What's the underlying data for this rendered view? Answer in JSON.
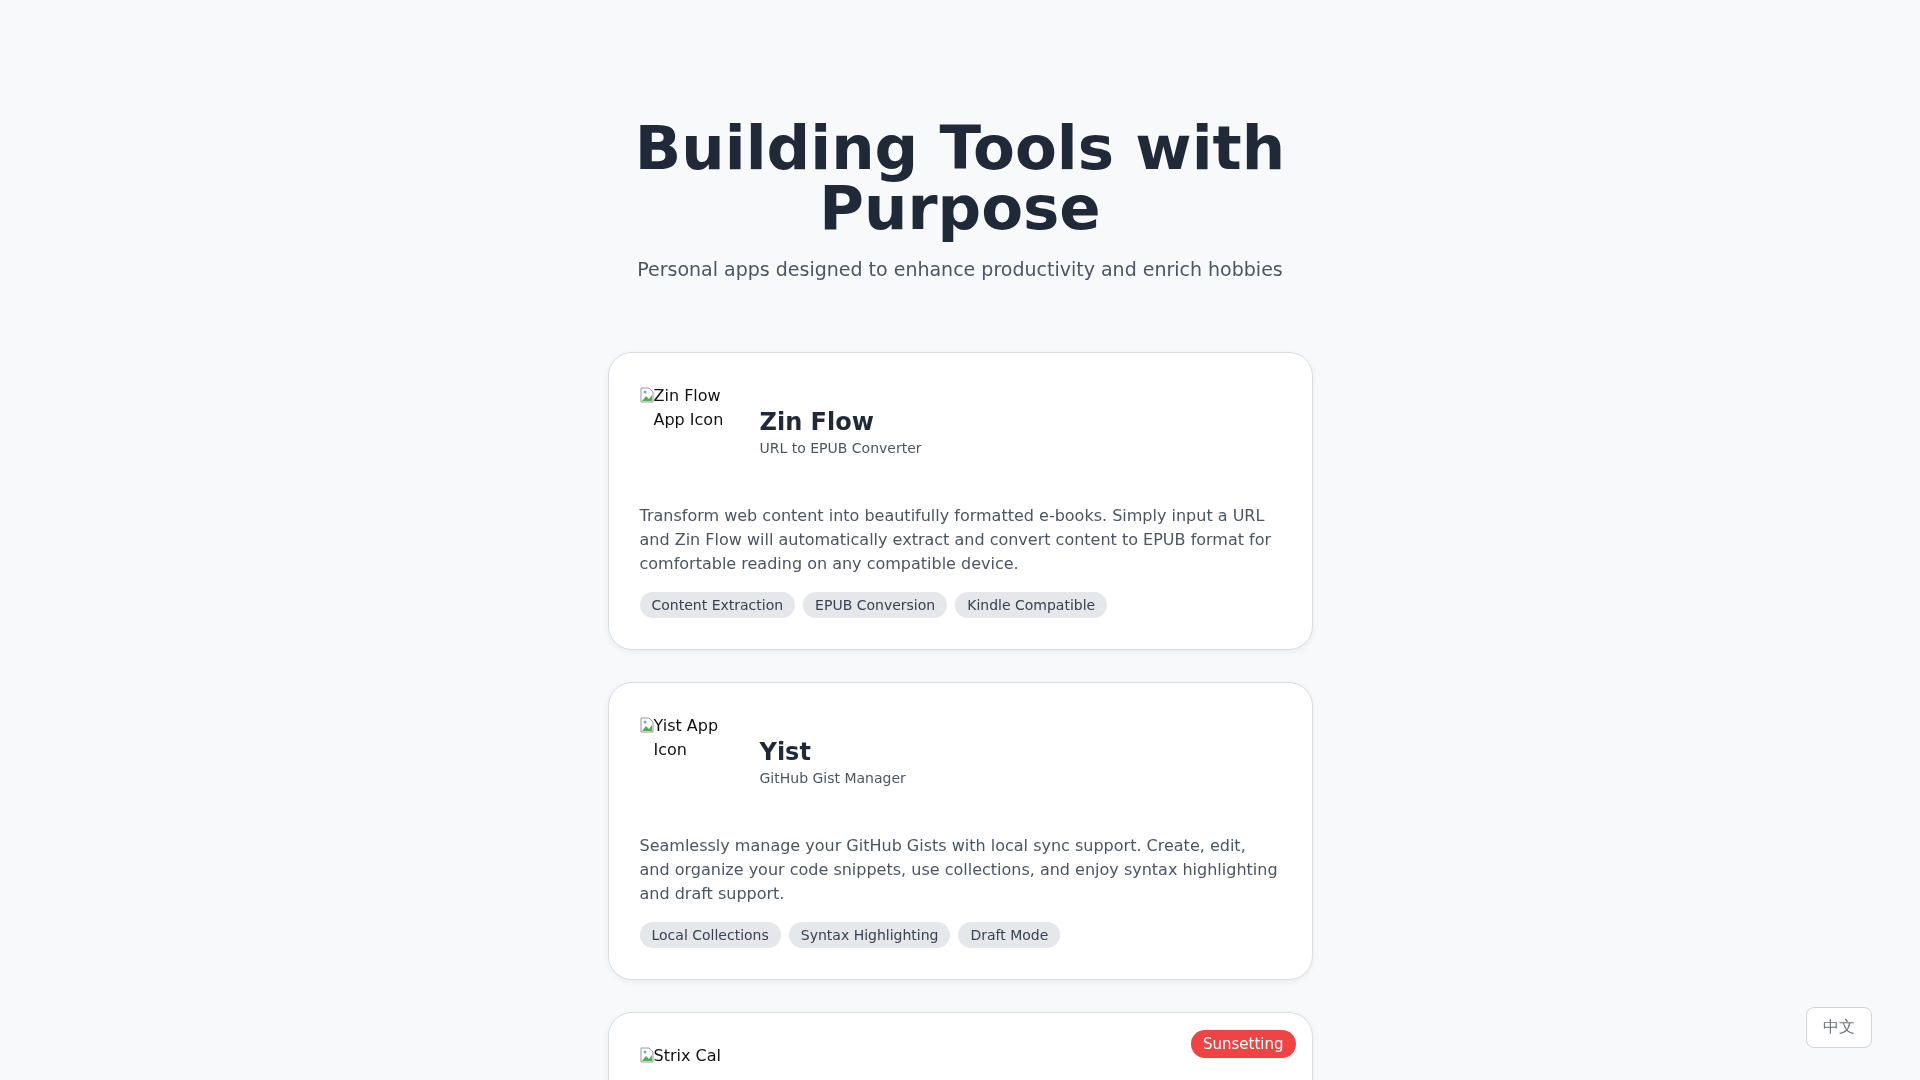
{
  "header": {
    "title": "Building Tools with Purpose",
    "subtitle": "Personal apps designed to enhance productivity and enrich hobbies"
  },
  "apps": [
    {
      "icon_alt": "Zin Flow App Icon",
      "name": "Zin Flow",
      "tagline": "URL to EPUB Converter",
      "description": "Transform web content into beautifully formatted e-books. Simply input a URL and Zin Flow will automatically extract and convert content to EPUB format for comfortable reading on any compatible device.",
      "tags": [
        "Content Extraction",
        "EPUB Conversion",
        "Kindle Compatible"
      ]
    },
    {
      "icon_alt": "Yist App Icon",
      "name": "Yist",
      "tagline": "GitHub Gist Manager",
      "description": "Seamlessly manage your GitHub Gists with local sync support. Create, edit, and organize your code snippets, use collections, and enjoy syntax highlighting and draft support.",
      "tags": [
        "Local Collections",
        "Syntax Highlighting",
        "Draft Mode"
      ]
    },
    {
      "icon_alt": "Strix Cal",
      "status": "Sunsetting"
    }
  ],
  "language_button": "中文"
}
